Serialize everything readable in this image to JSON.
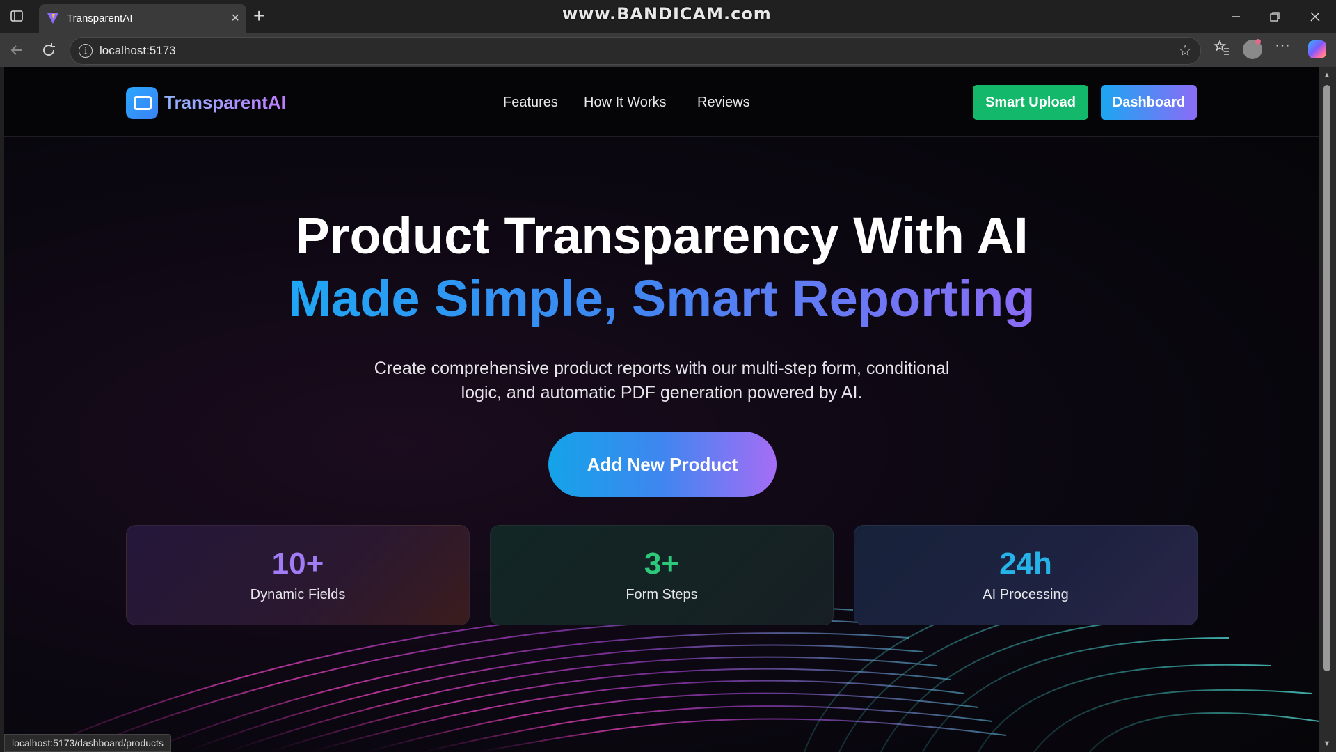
{
  "browser": {
    "tab_title": "TransparentAI",
    "tab_close": "×",
    "new_tab": "+",
    "watermark": "www.BANDICAM.com",
    "address": "localhost:5173",
    "status_url": "localhost:5173/dashboard/products"
  },
  "site": {
    "brand": "TransparentAI",
    "nav": [
      "Features",
      "How It Works",
      "Reviews"
    ],
    "smart_upload": "Smart Upload",
    "dashboard": "Dashboard"
  },
  "hero": {
    "title_line1": "Product Transparency With AI",
    "title_line2": "Made Simple, Smart Reporting",
    "subtitle": "Create comprehensive product reports with our multi-step form, conditional logic, and automatic PDF generation powered by AI.",
    "cta": "Add New Product"
  },
  "stats": [
    {
      "value": "10+",
      "label": "Dynamic Fields",
      "color": "#a07cf5"
    },
    {
      "value": "3+",
      "label": "Form Steps",
      "color": "#2cc97a"
    },
    {
      "value": "24h",
      "label": "AI Processing",
      "color": "#25b3e8"
    }
  ],
  "colors": {
    "accent_blue": "#1ea7f5",
    "accent_purple": "#8b6cf6",
    "upload_green": "#14b86a"
  }
}
